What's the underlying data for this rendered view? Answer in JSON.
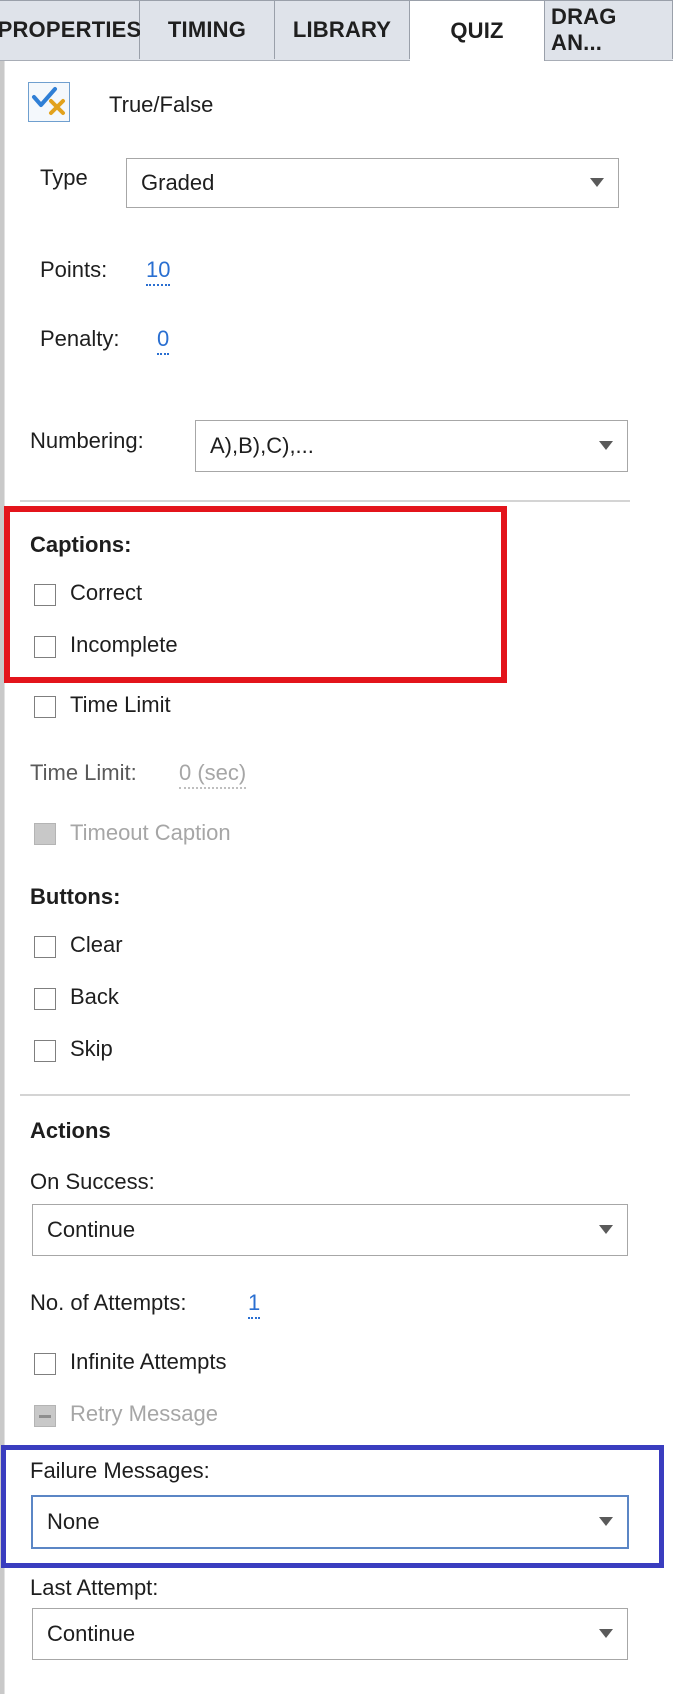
{
  "tabs": [
    "PROPERTIES",
    "TIMING",
    "LIBRARY",
    "QUIZ",
    "DRAG AN..."
  ],
  "active_tab": "QUIZ",
  "question_type_icon": "true-false-check-x-icon",
  "question_type": "True/False",
  "type": {
    "label": "Type",
    "value": "Graded"
  },
  "points": {
    "label": "Points:",
    "value": "10"
  },
  "penalty": {
    "label": "Penalty:",
    "value": "0"
  },
  "numbering": {
    "label": "Numbering:",
    "value": "A),B),C),..."
  },
  "captions": {
    "heading": "Captions:",
    "correct": {
      "label": "Correct",
      "checked": false
    },
    "incomplete": {
      "label": "Incomplete",
      "checked": false
    },
    "time_limit_checkbox": {
      "label": "Time Limit",
      "checked": false
    }
  },
  "time_limit": {
    "label": "Time Limit:",
    "value": "0 (sec)"
  },
  "timeout_caption": {
    "label": "Timeout Caption",
    "enabled": false
  },
  "buttons": {
    "heading": "Buttons:",
    "clear": {
      "label": "Clear",
      "checked": false
    },
    "back": {
      "label": "Back",
      "checked": false
    },
    "skip": {
      "label": "Skip",
      "checked": false
    }
  },
  "actions": {
    "heading": "Actions",
    "on_success": {
      "label": "On Success:",
      "value": "Continue"
    },
    "attempts": {
      "label": "No. of Attempts:",
      "value": "1"
    },
    "infinite_attempts": {
      "label": "Infinite Attempts",
      "checked": false
    },
    "retry_message": {
      "label": "Retry Message",
      "enabled": false
    },
    "failure_messages": {
      "label": "Failure Messages:",
      "value": "None"
    },
    "last_attempt": {
      "label": "Last Attempt:",
      "value": "Continue"
    }
  },
  "colors": {
    "link_blue": "#2a6fd1",
    "highlight_red": "#e3141b",
    "highlight_blue": "#3a3dbf",
    "tab_bg": "#dfe3ea"
  }
}
